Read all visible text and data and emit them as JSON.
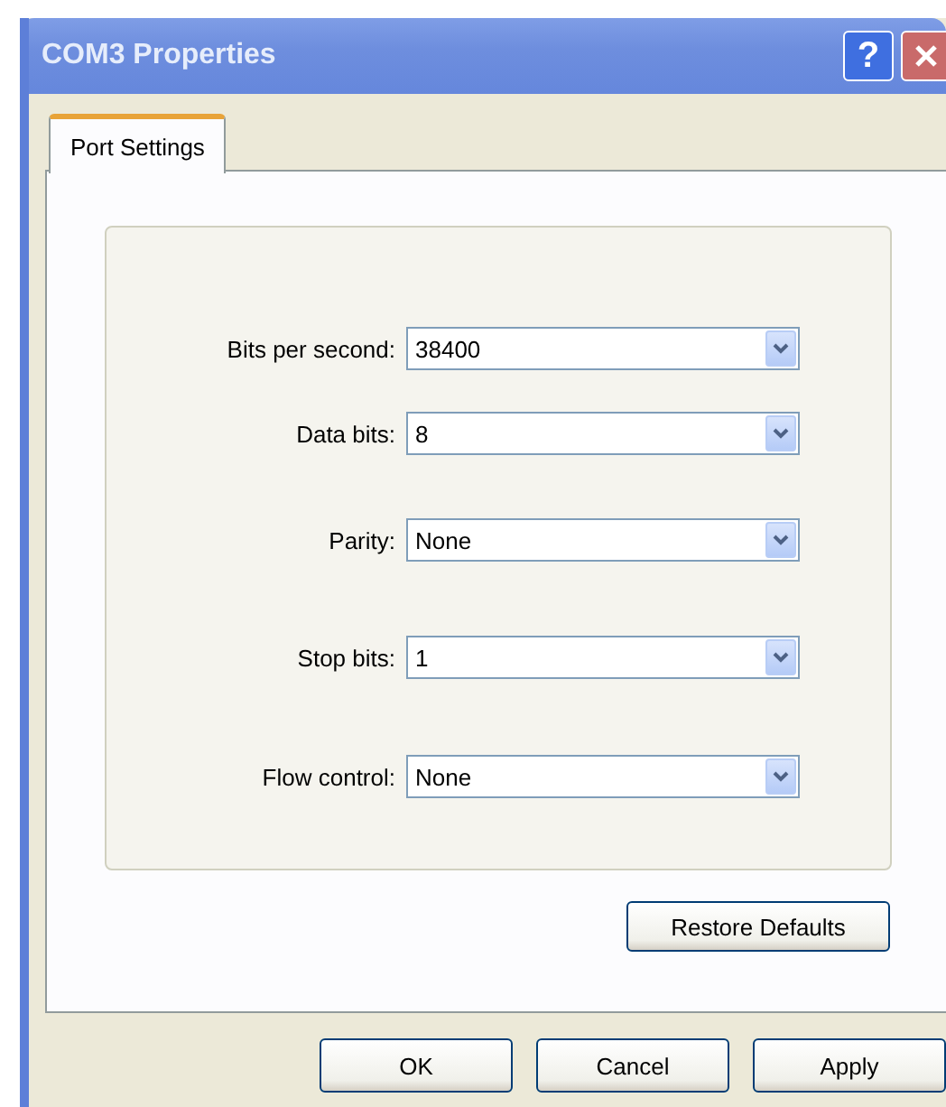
{
  "window": {
    "title": "COM3 Properties",
    "help_button": "?"
  },
  "tabs": [
    {
      "label": "Port Settings",
      "selected": true
    }
  ],
  "settings": [
    {
      "label": "Bits per second:",
      "value": "38400"
    },
    {
      "label": "Data bits:",
      "value": "8"
    },
    {
      "label": "Parity:",
      "value": "None"
    },
    {
      "label": "Stop bits:",
      "value": "1"
    },
    {
      "label": "Flow control:",
      "value": "None"
    }
  ],
  "restore_button": "Restore Defaults",
  "buttons": [
    "OK",
    "Cancel",
    "Apply"
  ]
}
